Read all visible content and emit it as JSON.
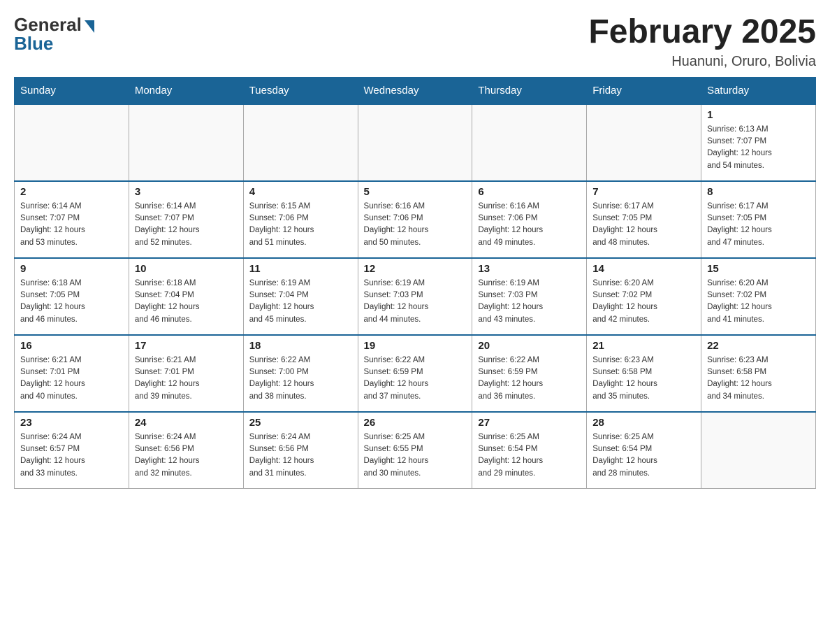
{
  "logo": {
    "general": "General",
    "blue": "Blue"
  },
  "title": "February 2025",
  "location": "Huanuni, Oruro, Bolivia",
  "days_of_week": [
    "Sunday",
    "Monday",
    "Tuesday",
    "Wednesday",
    "Thursday",
    "Friday",
    "Saturday"
  ],
  "weeks": [
    [
      {
        "day": "",
        "info": ""
      },
      {
        "day": "",
        "info": ""
      },
      {
        "day": "",
        "info": ""
      },
      {
        "day": "",
        "info": ""
      },
      {
        "day": "",
        "info": ""
      },
      {
        "day": "",
        "info": ""
      },
      {
        "day": "1",
        "info": "Sunrise: 6:13 AM\nSunset: 7:07 PM\nDaylight: 12 hours\nand 54 minutes."
      }
    ],
    [
      {
        "day": "2",
        "info": "Sunrise: 6:14 AM\nSunset: 7:07 PM\nDaylight: 12 hours\nand 53 minutes."
      },
      {
        "day": "3",
        "info": "Sunrise: 6:14 AM\nSunset: 7:07 PM\nDaylight: 12 hours\nand 52 minutes."
      },
      {
        "day": "4",
        "info": "Sunrise: 6:15 AM\nSunset: 7:06 PM\nDaylight: 12 hours\nand 51 minutes."
      },
      {
        "day": "5",
        "info": "Sunrise: 6:16 AM\nSunset: 7:06 PM\nDaylight: 12 hours\nand 50 minutes."
      },
      {
        "day": "6",
        "info": "Sunrise: 6:16 AM\nSunset: 7:06 PM\nDaylight: 12 hours\nand 49 minutes."
      },
      {
        "day": "7",
        "info": "Sunrise: 6:17 AM\nSunset: 7:05 PM\nDaylight: 12 hours\nand 48 minutes."
      },
      {
        "day": "8",
        "info": "Sunrise: 6:17 AM\nSunset: 7:05 PM\nDaylight: 12 hours\nand 47 minutes."
      }
    ],
    [
      {
        "day": "9",
        "info": "Sunrise: 6:18 AM\nSunset: 7:05 PM\nDaylight: 12 hours\nand 46 minutes."
      },
      {
        "day": "10",
        "info": "Sunrise: 6:18 AM\nSunset: 7:04 PM\nDaylight: 12 hours\nand 46 minutes."
      },
      {
        "day": "11",
        "info": "Sunrise: 6:19 AM\nSunset: 7:04 PM\nDaylight: 12 hours\nand 45 minutes."
      },
      {
        "day": "12",
        "info": "Sunrise: 6:19 AM\nSunset: 7:03 PM\nDaylight: 12 hours\nand 44 minutes."
      },
      {
        "day": "13",
        "info": "Sunrise: 6:19 AM\nSunset: 7:03 PM\nDaylight: 12 hours\nand 43 minutes."
      },
      {
        "day": "14",
        "info": "Sunrise: 6:20 AM\nSunset: 7:02 PM\nDaylight: 12 hours\nand 42 minutes."
      },
      {
        "day": "15",
        "info": "Sunrise: 6:20 AM\nSunset: 7:02 PM\nDaylight: 12 hours\nand 41 minutes."
      }
    ],
    [
      {
        "day": "16",
        "info": "Sunrise: 6:21 AM\nSunset: 7:01 PM\nDaylight: 12 hours\nand 40 minutes."
      },
      {
        "day": "17",
        "info": "Sunrise: 6:21 AM\nSunset: 7:01 PM\nDaylight: 12 hours\nand 39 minutes."
      },
      {
        "day": "18",
        "info": "Sunrise: 6:22 AM\nSunset: 7:00 PM\nDaylight: 12 hours\nand 38 minutes."
      },
      {
        "day": "19",
        "info": "Sunrise: 6:22 AM\nSunset: 6:59 PM\nDaylight: 12 hours\nand 37 minutes."
      },
      {
        "day": "20",
        "info": "Sunrise: 6:22 AM\nSunset: 6:59 PM\nDaylight: 12 hours\nand 36 minutes."
      },
      {
        "day": "21",
        "info": "Sunrise: 6:23 AM\nSunset: 6:58 PM\nDaylight: 12 hours\nand 35 minutes."
      },
      {
        "day": "22",
        "info": "Sunrise: 6:23 AM\nSunset: 6:58 PM\nDaylight: 12 hours\nand 34 minutes."
      }
    ],
    [
      {
        "day": "23",
        "info": "Sunrise: 6:24 AM\nSunset: 6:57 PM\nDaylight: 12 hours\nand 33 minutes."
      },
      {
        "day": "24",
        "info": "Sunrise: 6:24 AM\nSunset: 6:56 PM\nDaylight: 12 hours\nand 32 minutes."
      },
      {
        "day": "25",
        "info": "Sunrise: 6:24 AM\nSunset: 6:56 PM\nDaylight: 12 hours\nand 31 minutes."
      },
      {
        "day": "26",
        "info": "Sunrise: 6:25 AM\nSunset: 6:55 PM\nDaylight: 12 hours\nand 30 minutes."
      },
      {
        "day": "27",
        "info": "Sunrise: 6:25 AM\nSunset: 6:54 PM\nDaylight: 12 hours\nand 29 minutes."
      },
      {
        "day": "28",
        "info": "Sunrise: 6:25 AM\nSunset: 6:54 PM\nDaylight: 12 hours\nand 28 minutes."
      },
      {
        "day": "",
        "info": ""
      }
    ]
  ]
}
